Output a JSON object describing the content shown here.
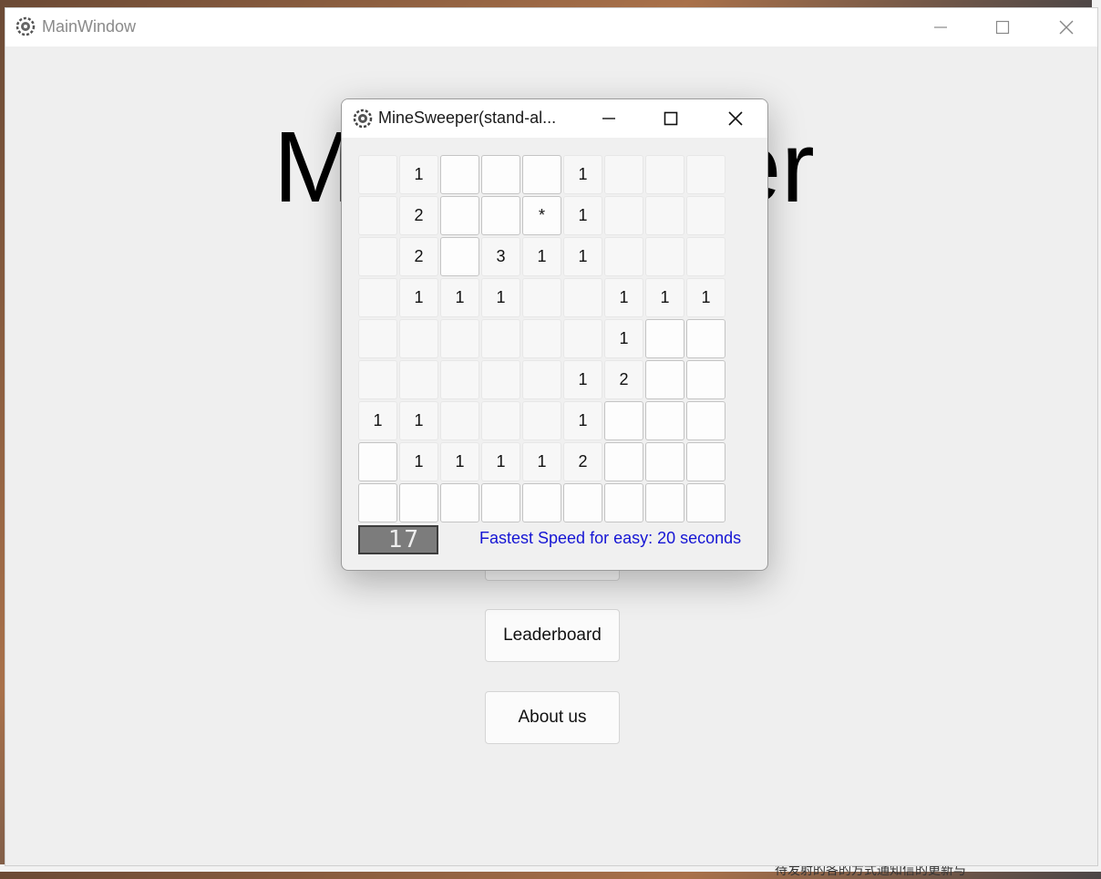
{
  "main_window": {
    "title": "MainWindow",
    "big_title_left": "M",
    "big_title_right": "er",
    "buttons": {
      "leaderboard": "Leaderboard",
      "about": "About us"
    }
  },
  "dialog": {
    "title": "MineSweeper(stand-al...",
    "counter": "17",
    "fastest_text": "Fastest Speed for easy: 20 seconds",
    "grid": [
      [
        {
          "t": "",
          "s": "r"
        },
        {
          "t": "1",
          "s": "r"
        },
        {
          "t": "",
          "s": "h"
        },
        {
          "t": "",
          "s": "h"
        },
        {
          "t": "",
          "s": "h"
        },
        {
          "t": "1",
          "s": "r"
        },
        {
          "t": "",
          "s": "r"
        },
        {
          "t": "",
          "s": "r"
        },
        {
          "t": "",
          "s": "r"
        }
      ],
      [
        {
          "t": "",
          "s": "r"
        },
        {
          "t": "2",
          "s": "r"
        },
        {
          "t": "",
          "s": "h"
        },
        {
          "t": "",
          "s": "h"
        },
        {
          "t": "*",
          "s": "h"
        },
        {
          "t": "1",
          "s": "r"
        },
        {
          "t": "",
          "s": "r"
        },
        {
          "t": "",
          "s": "r"
        },
        {
          "t": "",
          "s": "r"
        }
      ],
      [
        {
          "t": "",
          "s": "r"
        },
        {
          "t": "2",
          "s": "r"
        },
        {
          "t": "",
          "s": "h"
        },
        {
          "t": "3",
          "s": "r"
        },
        {
          "t": "1",
          "s": "r"
        },
        {
          "t": "1",
          "s": "r"
        },
        {
          "t": "",
          "s": "r"
        },
        {
          "t": "",
          "s": "r"
        },
        {
          "t": "",
          "s": "r"
        }
      ],
      [
        {
          "t": "",
          "s": "r"
        },
        {
          "t": "1",
          "s": "r"
        },
        {
          "t": "1",
          "s": "r"
        },
        {
          "t": "1",
          "s": "r"
        },
        {
          "t": "",
          "s": "r"
        },
        {
          "t": "",
          "s": "r"
        },
        {
          "t": "1",
          "s": "r"
        },
        {
          "t": "1",
          "s": "r"
        },
        {
          "t": "1",
          "s": "r"
        }
      ],
      [
        {
          "t": "",
          "s": "r"
        },
        {
          "t": "",
          "s": "r"
        },
        {
          "t": "",
          "s": "r"
        },
        {
          "t": "",
          "s": "r"
        },
        {
          "t": "",
          "s": "r"
        },
        {
          "t": "",
          "s": "r"
        },
        {
          "t": "1",
          "s": "r"
        },
        {
          "t": "",
          "s": "h"
        },
        {
          "t": "",
          "s": "h"
        }
      ],
      [
        {
          "t": "",
          "s": "r"
        },
        {
          "t": "",
          "s": "r"
        },
        {
          "t": "",
          "s": "r"
        },
        {
          "t": "",
          "s": "r"
        },
        {
          "t": "",
          "s": "r"
        },
        {
          "t": "1",
          "s": "r"
        },
        {
          "t": "2",
          "s": "r"
        },
        {
          "t": "",
          "s": "h"
        },
        {
          "t": "",
          "s": "h"
        }
      ],
      [
        {
          "t": "1",
          "s": "r"
        },
        {
          "t": "1",
          "s": "r"
        },
        {
          "t": "",
          "s": "r"
        },
        {
          "t": "",
          "s": "r"
        },
        {
          "t": "",
          "s": "r"
        },
        {
          "t": "1",
          "s": "r"
        },
        {
          "t": "",
          "s": "h"
        },
        {
          "t": "",
          "s": "h"
        },
        {
          "t": "",
          "s": "h"
        }
      ],
      [
        {
          "t": "",
          "s": "h"
        },
        {
          "t": "1",
          "s": "r"
        },
        {
          "t": "1",
          "s": "r"
        },
        {
          "t": "1",
          "s": "r"
        },
        {
          "t": "1",
          "s": "r"
        },
        {
          "t": "2",
          "s": "r"
        },
        {
          "t": "",
          "s": "h"
        },
        {
          "t": "",
          "s": "h"
        },
        {
          "t": "",
          "s": "h"
        }
      ],
      [
        {
          "t": "",
          "s": "h"
        },
        {
          "t": "",
          "s": "h"
        },
        {
          "t": "",
          "s": "h"
        },
        {
          "t": "",
          "s": "h"
        },
        {
          "t": "",
          "s": "h"
        },
        {
          "t": "",
          "s": "h"
        },
        {
          "t": "",
          "s": "h"
        },
        {
          "t": "",
          "s": "h"
        },
        {
          "t": "",
          "s": "h"
        }
      ]
    ]
  },
  "desktop": {
    "bottom_text": "待发射的各的方式通知信的更新与"
  },
  "colors": {
    "accent_text": "#1515d4",
    "lcd_background": "#7c7c7c"
  },
  "icons": [
    "app-gear-icon",
    "minimize-icon",
    "maximize-icon",
    "close-icon"
  ]
}
